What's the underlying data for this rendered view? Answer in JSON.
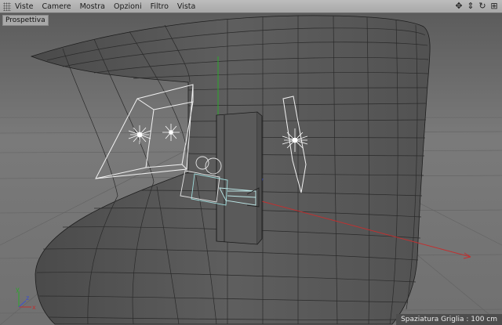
{
  "menubar": {
    "items": [
      "Viste",
      "Camere",
      "Mostra",
      "Opzioni",
      "Filtro",
      "Vista"
    ],
    "nav_icons": [
      "move-icon",
      "scale-icon",
      "rotate-icon",
      "maximize-icon"
    ]
  },
  "viewport": {
    "view_name": "Prospettiva",
    "grid_spacing": "Spaziatura Griglia : 100 cm",
    "axes": {
      "x": "x",
      "y": "y",
      "z": "z"
    }
  },
  "colors": {
    "menubar": "#b2b2b2",
    "background": "#707070",
    "surface": "#585858",
    "x_axis": "#c03030",
    "y_axis": "#2aa82a",
    "z_axis": "#3a4fd0"
  }
}
